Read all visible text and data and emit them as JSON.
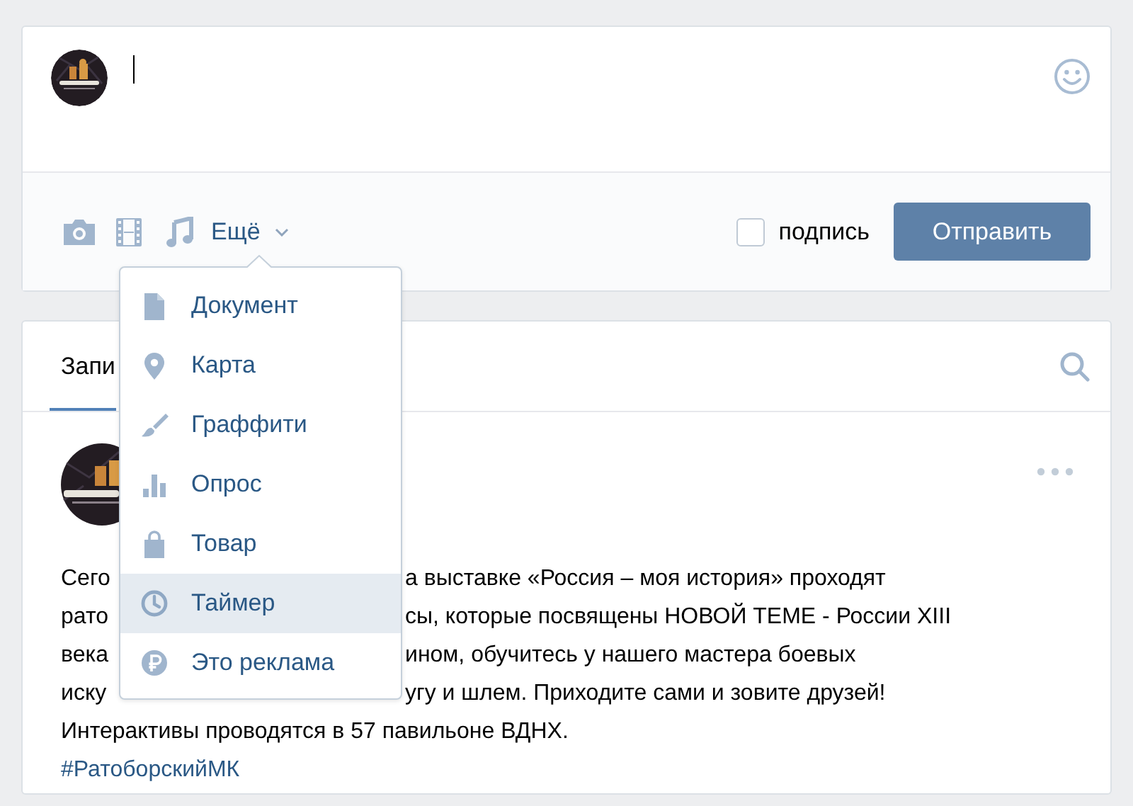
{
  "composer": {
    "more_label": "Ещё",
    "signature": {
      "label": "подпись",
      "checked": false
    },
    "send_button": "Отправить"
  },
  "menu": {
    "items": [
      {
        "label": "Документ",
        "kind": "document",
        "selected": false
      },
      {
        "label": "Карта",
        "kind": "pin",
        "selected": false
      },
      {
        "label": "Граффити",
        "kind": "brush",
        "selected": false
      },
      {
        "label": "Опрос",
        "kind": "poll",
        "selected": false
      },
      {
        "label": "Товар",
        "kind": "bag",
        "selected": false
      },
      {
        "label": "Таймер",
        "kind": "clock",
        "selected": true
      },
      {
        "label": "Это реклама",
        "kind": "ruble",
        "selected": false
      }
    ]
  },
  "wall": {
    "tabs": [
      {
        "label": "Запи",
        "selected": true
      }
    ],
    "post": {
      "lines": [
        {
          "left": "Сего",
          "right": "а выставке «Россия – моя история» проходят"
        },
        {
          "left": "рато",
          "right": "сы, которые посвящены НОВОЙ ТЕМЕ - России XIII"
        },
        {
          "left": "века",
          "right": "ином, обучитесь у нашего мастера боевых"
        },
        {
          "left": "иску",
          "right": "угу и шлем. Приходите сами и зовите друзей!"
        },
        {
          "text": "Интерактивы проводятся в 57 павильоне ВДНХ."
        }
      ],
      "hashtag": "#РатоборскийМК"
    }
  }
}
